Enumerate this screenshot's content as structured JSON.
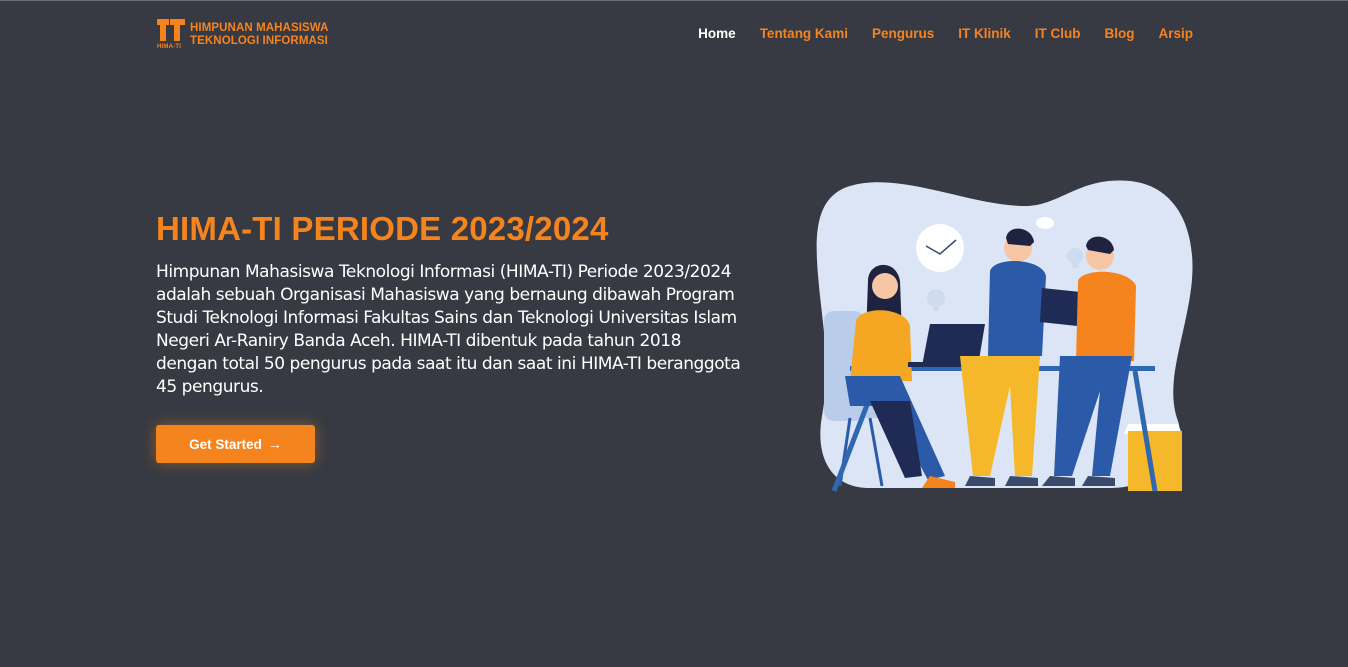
{
  "brand": {
    "title_line1": "HIMPUNAN MAHASISWA",
    "title_line2": "TEKNOLOGI INFORMASI",
    "sub": "HIMA-TI",
    "color": "#f5841f"
  },
  "nav": {
    "items": [
      {
        "label": "Home",
        "active": true
      },
      {
        "label": "Tentang Kami",
        "active": false
      },
      {
        "label": "Pengurus",
        "active": false
      },
      {
        "label": "IT Klinik",
        "active": false
      },
      {
        "label": "IT Club",
        "active": false
      },
      {
        "label": "Blog",
        "active": false
      },
      {
        "label": "Arsip",
        "active": false
      }
    ]
  },
  "hero": {
    "title": "HIMA-TI PERIODE 2023/2024",
    "description": "Himpunan Mahasiswa Teknologi Informasi (HIMA-TI) Periode 2023/2024 adalah sebuah Organisasi Mahasiswa yang bernaung dibawah Program Studi Teknologi Informasi Fakultas Sains dan Teknologi Universitas Islam Negeri Ar-Raniry Banda Aceh. HIMA-TI dibentuk pada tahun 2018 dengan total 50 pengurus pada saat itu dan saat ini HIMA-TI beranggota 45 pengurus.",
    "cta_label": "Get Started",
    "cta_icon": "arrow-right-icon"
  },
  "colors": {
    "background": "#373a42",
    "accent": "#f5841f",
    "text": "#ffffff"
  }
}
